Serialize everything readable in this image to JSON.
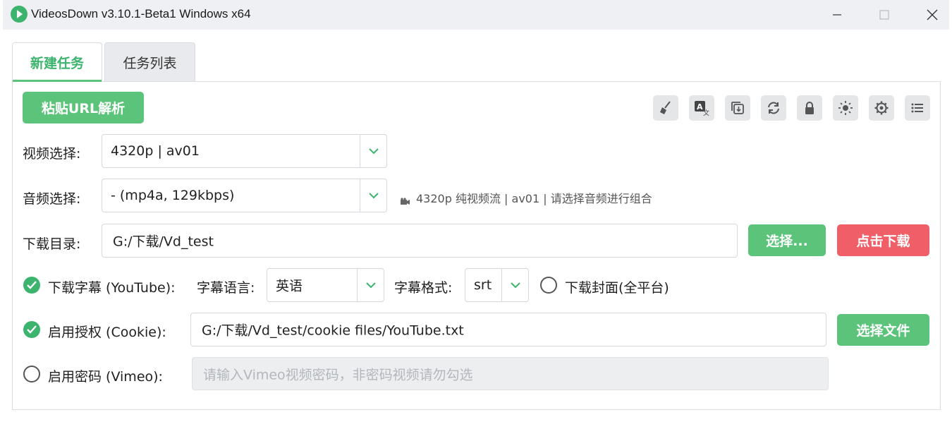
{
  "window": {
    "title": "VideosDown v3.10.1-Beta1 Windows x64",
    "accent": "#3cb46e",
    "danger": "#f05e67"
  },
  "tabs": [
    {
      "label": "新建任务",
      "active": true
    },
    {
      "label": "任务列表",
      "active": false
    }
  ],
  "toolbar": {
    "paste_button": "粘贴URL解析",
    "tools": [
      "broom-icon",
      "translate-icon",
      "copy-download-icon",
      "refresh-icon",
      "lock-icon",
      "brightness-icon",
      "settings-icon",
      "list-icon"
    ]
  },
  "video": {
    "label": "视频选择:",
    "value": "4320p | av01"
  },
  "audio": {
    "label": "音频选择:",
    "value": "- (mp4a, 129kbps)",
    "info": "4320p 纯视频流 | av01 | 请选择音频进行组合"
  },
  "dir": {
    "label": "下载目录:",
    "value": "G:/下载/Vd_test",
    "choose_button": "选择...",
    "download_button": "点击下载"
  },
  "subtitle": {
    "checkbox_label": "下载字幕 (YouTube):",
    "checked": true,
    "lang_label": "字幕语言:",
    "lang_value": "英语",
    "format_label": "字幕格式:",
    "format_value": "srt",
    "cover_label": "下载封面(全平台)",
    "cover_checked": false
  },
  "cookie": {
    "checkbox_label": "启用授权 (Cookie):",
    "checked": true,
    "value": "G:/下载/Vd_test/cookie files/YouTube.txt",
    "button": "选择文件"
  },
  "vimeo": {
    "checkbox_label": "启用密码 (Vimeo):",
    "checked": false,
    "placeholder": "请输入Vimeo视频密码，非密码视频请勿勾选"
  }
}
